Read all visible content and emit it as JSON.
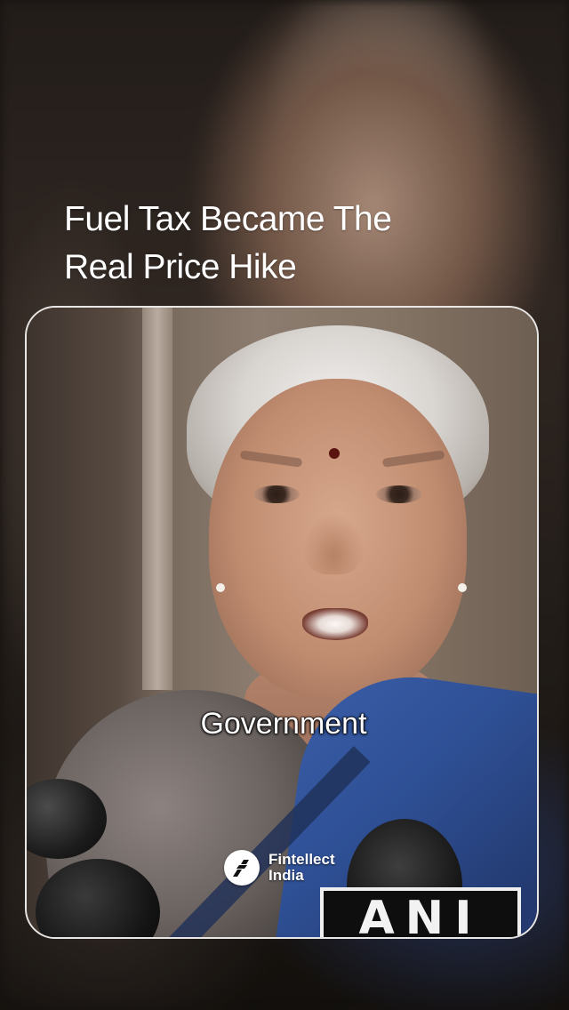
{
  "headline": {
    "line1": "Fuel Tax Became The",
    "line2": "Real Price Hike"
  },
  "video": {
    "caption": "Government",
    "mic_plate_text": "ANI"
  },
  "brand": {
    "line1": "Fintellect",
    "line2": "India",
    "logo_icon": "fintellect-logo-icon"
  },
  "colors": {
    "text": "#ffffff",
    "card_border": "#ffffff",
    "saree_blue": "#2e4f94"
  }
}
